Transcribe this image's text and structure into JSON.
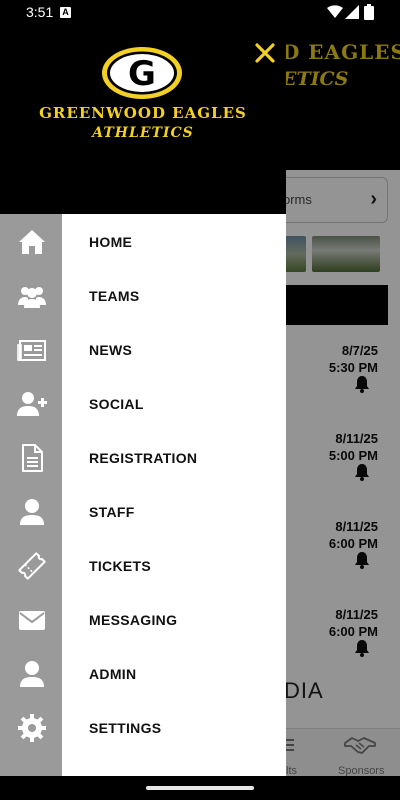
{
  "status_bar": {
    "time": "3:51",
    "notification_icon": "A"
  },
  "brand": {
    "title": "GREENWOOD EAGLES",
    "subtitle": "ATHLETICS",
    "logo_letter": "G",
    "color_primary": "#f2d024",
    "color_dark": "#000000"
  },
  "background": {
    "brand_fragment_1": "D EAGLES",
    "brand_fragment_2": "ETICS",
    "forms_card_label": "orms",
    "events": [
      {
        "date": "8/7/25",
        "time": "5:30 PM"
      },
      {
        "date": "8/11/25",
        "time": "5:00 PM"
      },
      {
        "date": "8/11/25",
        "time": "6:00 PM"
      },
      {
        "date": "8/11/25",
        "time": "6:00 PM"
      }
    ],
    "media_label": "DIA",
    "bottom_nav": {
      "results_label": "lts",
      "sponsors_label": "Sponsors"
    }
  },
  "menu": {
    "items": [
      {
        "label": "HOME",
        "icon": "home-icon"
      },
      {
        "label": "TEAMS",
        "icon": "teams-icon"
      },
      {
        "label": "NEWS",
        "icon": "newspaper-icon"
      },
      {
        "label": "SOCIAL",
        "icon": "add-user-icon"
      },
      {
        "label": "REGISTRATION",
        "icon": "document-icon"
      },
      {
        "label": "STAFF",
        "icon": "person-icon"
      },
      {
        "label": "TICKETS",
        "icon": "ticket-icon"
      },
      {
        "label": "MESSAGING",
        "icon": "envelope-icon"
      },
      {
        "label": "ADMIN",
        "icon": "person-icon"
      },
      {
        "label": "SETTINGS",
        "icon": "gear-icon"
      }
    ]
  }
}
